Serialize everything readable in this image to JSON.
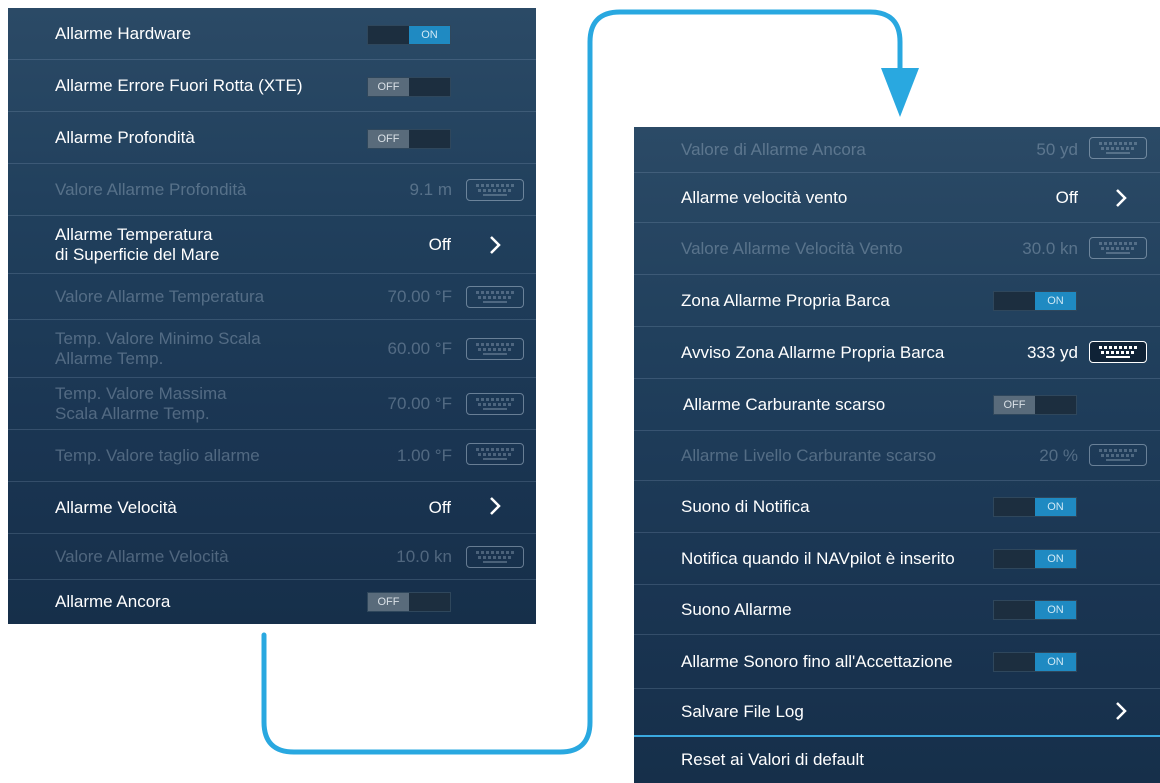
{
  "left_panel": {
    "rows": [
      {
        "label": "Allarme Hardware",
        "toggle": "ON"
      },
      {
        "label": "Allarme Errore Fuori Rotta (XTE)",
        "toggle": "OFF"
      },
      {
        "label": "Allarme Profondità",
        "toggle": "OFF"
      },
      {
        "label": "Valore Allarme Profondità",
        "value": "9.1 m"
      },
      {
        "label_line1": "Allarme Temperatura",
        "label_line2": "di Superficie del Mare",
        "value": "Off"
      },
      {
        "label": "Valore Allarme Temperatura",
        "value": "70.00 °F"
      },
      {
        "label_line1": "Temp. Valore Minimo Scala",
        "label_line2": "Allarme Temp.",
        "value": "60.00 °F"
      },
      {
        "label_line1": "Temp. Valore Massima",
        "label_line2": "Scala Allarme Temp.",
        "value": "70.00 °F"
      },
      {
        "label": "Temp. Valore taglio allarme",
        "value": "1.00 °F"
      },
      {
        "label": "Allarme Velocità",
        "value": "Off"
      },
      {
        "label": "Valore Allarme Velocità",
        "value": "10.0 kn"
      },
      {
        "label": "Allarme Ancora",
        "toggle": "OFF"
      }
    ]
  },
  "right_panel": {
    "rows": [
      {
        "label": "Valore di Allarme Ancora",
        "value": "50 yd"
      },
      {
        "label": "Allarme velocità vento",
        "value": "Off"
      },
      {
        "label": "Valore Allarme Velocità Vento",
        "value": "30.0 kn"
      },
      {
        "label": "Zona Allarme Propria Barca",
        "toggle": "ON"
      },
      {
        "label": "Avviso Zona Allarme Propria Barca",
        "value": "333 yd"
      },
      {
        "label": "Allarme Carburante scarso",
        "toggle": "OFF"
      },
      {
        "label": "Allarme Livello Carburante scarso",
        "value": "20 %"
      },
      {
        "label": "Suono di Notifica",
        "toggle": "ON"
      },
      {
        "label": "Notifica quando il NAVpilot è inserito",
        "toggle": "ON"
      },
      {
        "label": "Suono Allarme",
        "toggle": "ON"
      },
      {
        "label": "Allarme Sonoro fino all'Accettazione",
        "toggle": "ON"
      },
      {
        "label": "Salvare File Log"
      },
      {
        "label": "Reset ai Valori di default"
      }
    ]
  },
  "icons": {
    "keyboard": "keyboard-icon",
    "chevron": "chevron-right-icon",
    "flow_arrow": "arrow-down-icon"
  },
  "colors": {
    "accent": "#1f8ac2",
    "connector": "#29a8e0",
    "panel_bg": "#1f3d5a"
  }
}
